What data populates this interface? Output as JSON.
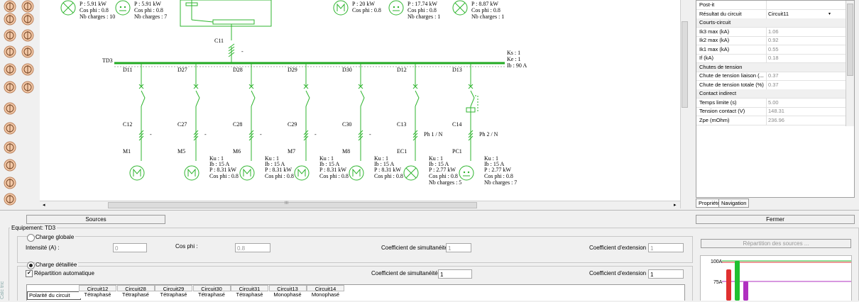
{
  "canvas": {
    "top_loads": [
      {
        "p": "P : 5.91 kW",
        "cos": "Cos phi : 0.8",
        "nb": "Nb charges : 10"
      },
      {
        "p": "P : 5.91 kW",
        "cos": "Cos phi : 0.8",
        "nb": "Nb charges : 7"
      },
      {
        "p": "P : 20 kW",
        "cos": "Cos phi : 0.8",
        "nb": ""
      },
      {
        "p": "P : 17.74 kW",
        "cos": "Cos phi : 0.8",
        "nb": "Nb charges : 1"
      },
      {
        "p": "P : 8.87 kW",
        "cos": "Cos phi : 0.8",
        "nb": "Nb charges : 1"
      }
    ],
    "feeder_label": "C11",
    "feeder_mark": "-",
    "busbar_label": "TD3",
    "busbar_info": [
      "Ks : 1",
      "Ke : 1",
      "Ib : 90 A"
    ],
    "circuits": [
      {
        "d": "D11",
        "c": "C12",
        "m": "M1",
        "type": "motor",
        "ph": "-",
        "ku": "",
        "ib": "",
        "p": "",
        "cos": "",
        "nb": ""
      },
      {
        "d": "D27",
        "c": "C27",
        "m": "M5",
        "type": "motor",
        "ph": "-",
        "ku": "Ku : 1",
        "ib": "Ib : 15 A",
        "p": "P : 8.31 kW",
        "cos": "Cos phi : 0.8",
        "nb": ""
      },
      {
        "d": "D28",
        "c": "C28",
        "m": "M6",
        "type": "motor",
        "ph": "-",
        "ku": "Ku : 1",
        "ib": "Ib : 15 A",
        "p": "P : 8.31 kW",
        "cos": "Cos phi : 0.8",
        "nb": ""
      },
      {
        "d": "D29",
        "c": "C29",
        "m": "M7",
        "type": "motor",
        "ph": "-",
        "ku": "Ku : 1",
        "ib": "Ib : 15 A",
        "p": "P : 8.31 kW",
        "cos": "Cos phi : 0.8",
        "nb": ""
      },
      {
        "d": "D30",
        "c": "C30",
        "m": "M8",
        "type": "motor",
        "ph": "-",
        "ku": "Ku : 1",
        "ib": "Ib : 15 A",
        "p": "P : 8.31 kW",
        "cos": "Cos phi : 0.8",
        "nb": ""
      },
      {
        "d": "D12",
        "c": "C13",
        "m": "EC1",
        "type": "lamp",
        "ph": "Ph 1 / N",
        "ku": "Ku : 1",
        "ib": "Ib : 15 A",
        "p": "P : 2.77 kW",
        "cos": "Cos phi : 0.8",
        "nb": "Nb charges : 5"
      },
      {
        "d": "D13",
        "c": "C14",
        "m": "PC1",
        "type": "socket",
        "ph": "Ph 2 / N",
        "ku": "Ku : 1",
        "ib": "Ib : 15 A",
        "p": "P : 2.77 kW",
        "cos": "Cos phi : 0.8",
        "nb": "Nb charges : 7"
      }
    ],
    "scroll_grip": "III"
  },
  "properties": {
    "rows": [
      {
        "label": "Post-it",
        "value": "",
        "section": false
      },
      {
        "label": "Résultat du circuit",
        "value": "Circuit11",
        "section": false,
        "dropdown": true
      },
      {
        "label": "Courts-circuit",
        "value": "",
        "section": true
      },
      {
        "label": "Ik3 max (kA)",
        "value": "1.06",
        "section": false
      },
      {
        "label": "Ik2 max (kA)",
        "value": "0.92",
        "section": false
      },
      {
        "label": "Ik1 max (kA)",
        "value": "0.55",
        "section": false
      },
      {
        "label": "If (kA)",
        "value": "0.18",
        "section": false
      },
      {
        "label": "Chutes de tension",
        "value": "",
        "section": true
      },
      {
        "label": "Chute de tension liaison (...",
        "value": "0.37",
        "section": false
      },
      {
        "label": "Chute de tension totale (%)",
        "value": "0.37",
        "section": false
      },
      {
        "label": "Contact indirect",
        "value": "",
        "section": true
      },
      {
        "label": "Temps limite (s)",
        "value": "5.00",
        "section": false
      },
      {
        "label": "Tension contact (V)",
        "value": "148.31",
        "section": false
      },
      {
        "label": "Zpe (mOhm)",
        "value": "236.96",
        "section": false
      }
    ],
    "tabs": [
      "Propriété",
      "Navigation"
    ]
  },
  "bottom": {
    "sources_button": "Sources",
    "fermer_button": "Fermer",
    "equipment_label": "Equipement: TD3",
    "charge_globale": "Charge globale",
    "intensite_label": "Intensité (A) :",
    "intensite_value": "0",
    "cosphi_label": "Cos phi :",
    "cosphi_value": "0.8",
    "coef_simult_label": "Coefficient de simultanéité :",
    "coef_simult_value": "1",
    "coef_ext_label": "Coefficient d'extension :",
    "coef_ext_value": "1",
    "repartition_sources_button": "Répartition des sources ...",
    "charge_detaillee": "Charge détaillée",
    "repartition_auto": "Répartition automatique",
    "coef_simult2_value": "1",
    "coef_ext2_value": "1",
    "table_headers": [
      "Circuit12",
      "Circuit28",
      "Circuit29",
      "Circuit30",
      "Circuit31",
      "Circuit13",
      "Circuit14"
    ],
    "table_row_label": "Polarité du circuit",
    "table_row_values": [
      "Tétraphasé",
      "Tétraphasé",
      "Tétraphasé",
      "Tétraphasé",
      "Tétraphasé",
      "Monophasé",
      "Monophasé"
    ],
    "side_label": "Calc tric"
  },
  "mini_chart": {
    "y_ticks": [
      "100A",
      "75A"
    ],
    "bars": [
      {
        "value": 100,
        "color": "#e03030"
      },
      {
        "value": 100,
        "color": "#20c030"
      },
      {
        "value": 75,
        "color": "#b030c0"
      }
    ],
    "ymax": 100
  },
  "colors": {
    "diagram": "#2fb52f",
    "busbar": "#22aa22"
  }
}
